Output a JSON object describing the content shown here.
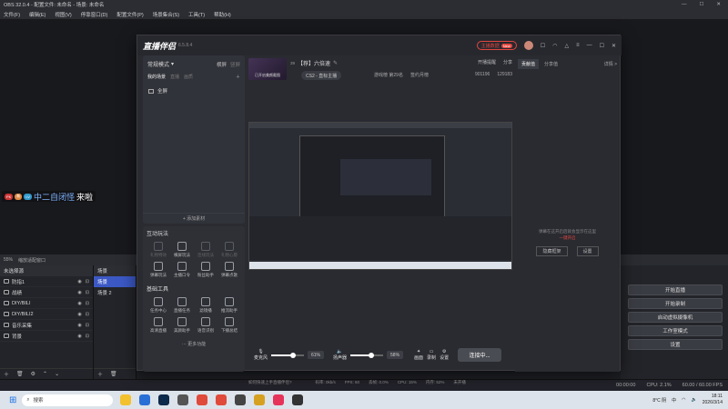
{
  "obs": {
    "title": "OBS 32.0.4 - 配置文件: 未命名 - 场景: 未命名",
    "menu": [
      "文件(F)",
      "编辑(E)",
      "视图(V)",
      "停靠窗口(D)",
      "配置文件(P)",
      "场景集合(S)",
      "工具(T)",
      "帮助(H)"
    ],
    "chat": {
      "badges": [
        "PK",
        "新",
        "LV"
      ],
      "nickname": "中二自闭怪",
      "message": "来啦"
    },
    "bar": {
      "zoom": "55%",
      "scale": "缩放适配窗口"
    },
    "sources_header": "未选择源",
    "sources_tabs": [
      "属性",
      "滤镜"
    ],
    "sources": [
      "防指1",
      "战绩",
      "DIY/BILI",
      "DIY/BILI2",
      "音乐采集",
      "背景"
    ],
    "scenes_header": "场景",
    "scenes": [
      "场景",
      "场景 2"
    ],
    "controls": [
      "开始直播",
      "开始录制",
      "启动虚拟摄像机",
      "工作室模式",
      "设置"
    ],
    "status": {
      "time": "00:00:00",
      "cpu": "CPU: 2.1%",
      "fps": "60.00 / 60.00 FPS"
    }
  },
  "zb": {
    "logo": "直播伴侣",
    "version": "6.5.8.4",
    "anchor_center": "主播数据",
    "new_tag": "New",
    "mode_label": "常规模式",
    "mode_tabs": [
      "横屏",
      "竖屏"
    ],
    "scene_tabs": [
      "我的场景",
      "直播",
      "画质"
    ],
    "source_item": "全屏",
    "add_material": "+ 添加素材",
    "tools_title": "互动玩法",
    "tools1": [
      "礼物特效",
      "横屏玩法",
      "连线玩法",
      "礼物心愿",
      "弹幕玩法",
      "主播口令",
      "粉丝助手",
      "弹幕点歌"
    ],
    "tools2_title": "基础工具",
    "tools2": [
      "任务中心",
      "直播任务",
      "滤镜播",
      "推流助手",
      "高清直播",
      "美颜助手",
      "语音识别",
      "下播总结"
    ],
    "more_tools": "··· 更多功能",
    "live_title": "【荐】六倍速",
    "live_id": "39",
    "stream_thumb": "已开启美颜截图",
    "cat_tags": [
      "CS2 - 直标主播"
    ],
    "stats": [
      "游戏榜 第29名",
      "签约月榜"
    ],
    "open_live": "开播提醒",
    "share": "分享",
    "rank_likes": "901196",
    "rank_hearts": "129183",
    "right_tabs": [
      "贡献值",
      "分享值"
    ],
    "right_more": "详情 >",
    "right_placeholder": "弹幕在这开启后就会显示在这里",
    "right_link": "一键开启",
    "right_btn1": "隐藏框架",
    "right_btn2": "设置",
    "mic_label": "麦克风",
    "mic_value": "61%",
    "spk_label": "扬声器",
    "spk_value": "58%",
    "tools_bottom": [
      "画面",
      "录制",
      "设置"
    ],
    "connect_btn": "连接中...",
    "hint": "如何快速上手直播伴侣?",
    "metrics": [
      "码率: 0kb/s",
      "FPS: 60",
      "丢帧: 0.0%",
      "CPU: 15%",
      "内存: 52%",
      "未开播"
    ]
  },
  "taskbar": {
    "search_placeholder": "搜索",
    "weather": "8°C 阴",
    "lang": "中",
    "time": "18:11",
    "date": "2026/3/14"
  },
  "colors": {
    "accent": "#3b58c4",
    "danger": "#e0463f"
  }
}
